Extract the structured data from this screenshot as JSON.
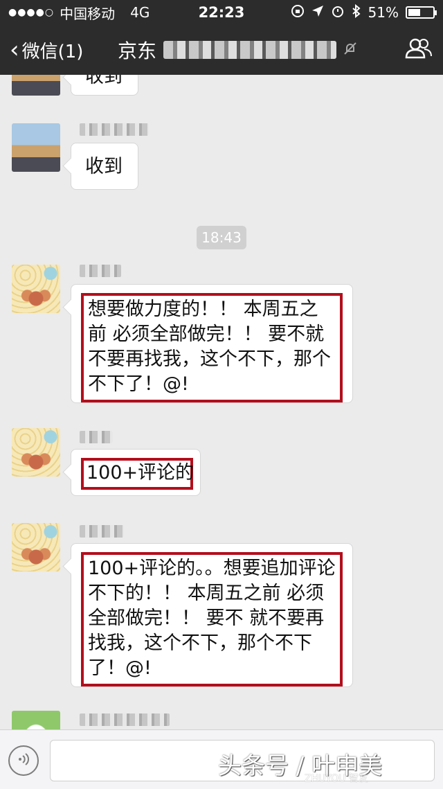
{
  "status_bar": {
    "signal": "●●●●○",
    "carrier": "中国移动",
    "network": "4G",
    "time": "22:23",
    "battery": "51%",
    "battery_level": 0.51
  },
  "nav": {
    "back_label": "微信(1)",
    "chat_title": "京东",
    "mute_icon": "muted-bell-icon",
    "group_icon": "group-members-icon"
  },
  "chat": {
    "messages": [
      {
        "text": "收到"
      },
      {
        "text": "收到"
      },
      {
        "text": "想要做力度的！！ 本周五之前 必须全部做完！！ 要不就不要再找我，这个不下，那个不下了！@!"
      },
      {
        "text": "100+评论的"
      },
      {
        "text": "100+评论的。。想要追加评论不下的！！ 本周五之前 必须全部做完！！ 要不 就不要再找我，这个不下，那个不下了！@!"
      }
    ],
    "timestamp": "18:43"
  },
  "input": {
    "voice_icon": "voice-icon"
  },
  "watermark": {
    "text": "头条号 / 叶申美",
    "sub": "ZHUYOU 智友"
  }
}
